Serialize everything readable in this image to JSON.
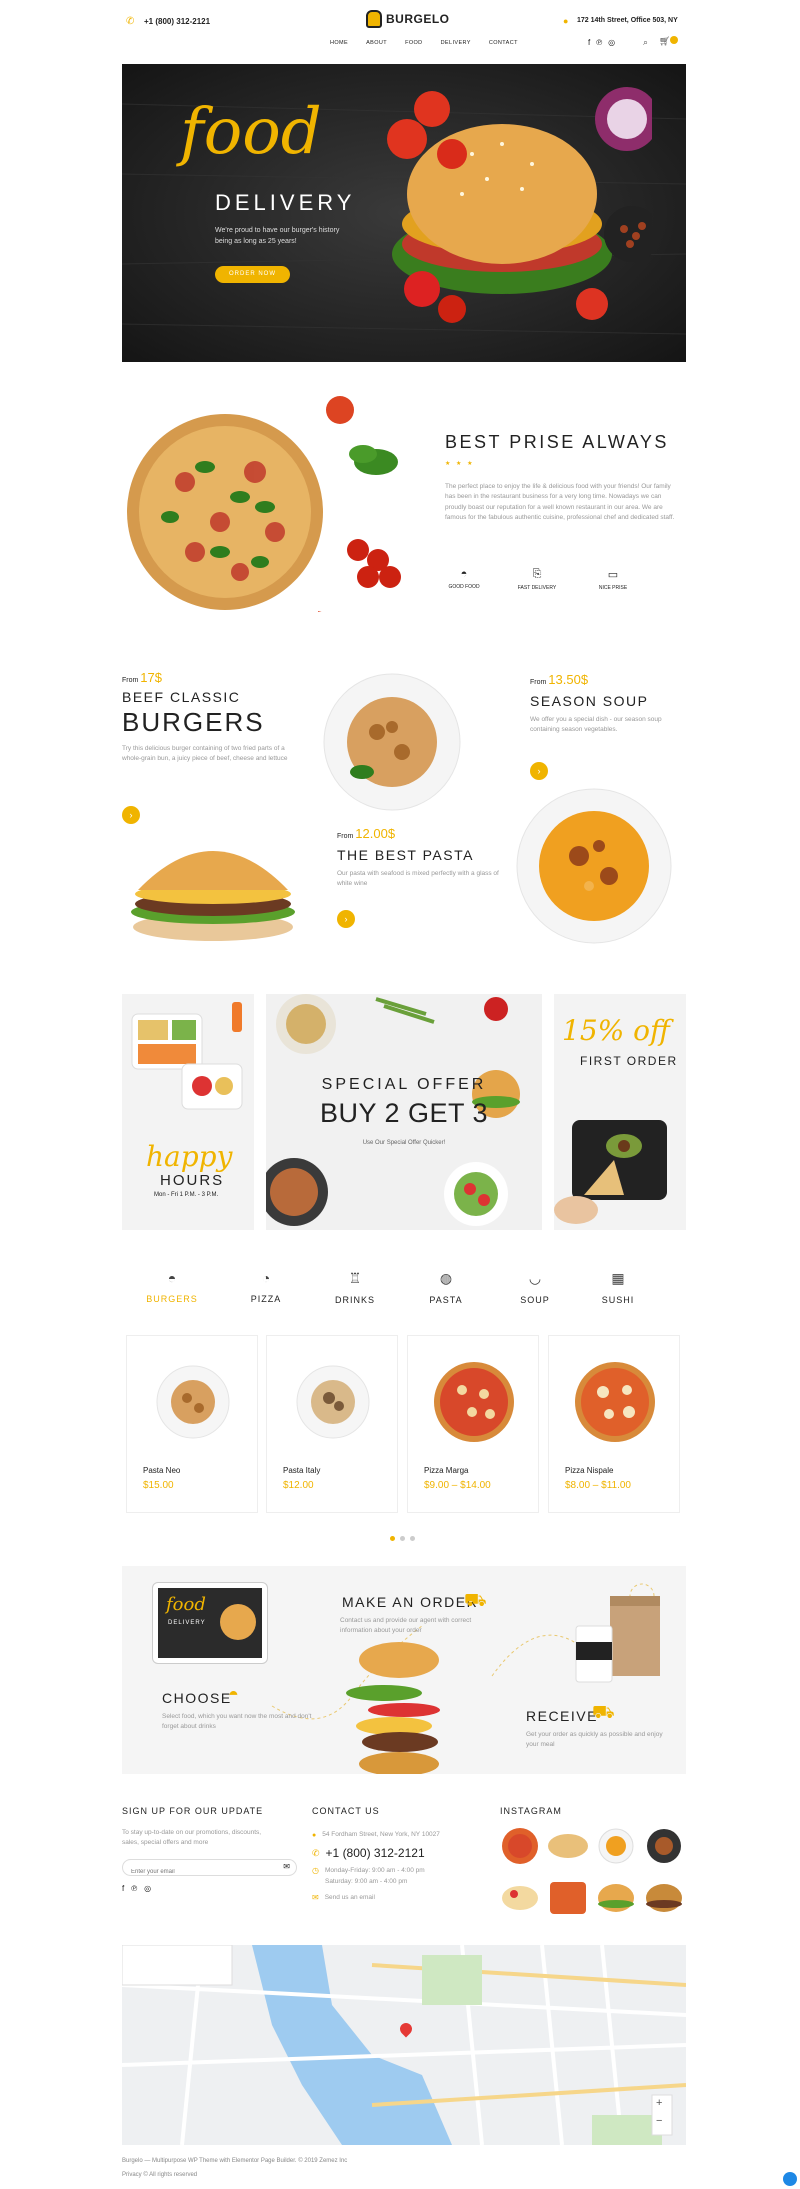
{
  "header": {
    "phone": "+1 (800) 312-2121",
    "logo_text": "BURGELO",
    "address": "172 14th Street, Office 503, NY",
    "nav": [
      "HOME",
      "ABOUT",
      "FOOD",
      "DELIVERY",
      "CONTACT"
    ],
    "cart_count": ""
  },
  "hero": {
    "script_title": "food",
    "title": "DELIVERY",
    "subtitle": "We're proud to have our burger's history being as long as 25 years!",
    "button": "ORDER NOW"
  },
  "about": {
    "title": "BEST PRISE ALWAYS",
    "stars": "★ ★ ★",
    "text": "The perfect place to enjoy the life & delicious food with your friends! Our family has been in the restaurant business for a very long time. Nowadays we can proudly boast our reputation for a well known restaurant in our area. We are famous for the fabulous authentic cuisine, professional chef and dedicated staff.",
    "features": [
      "GOOD FOOD",
      "FAST DELIVERY",
      "NICE PRISE"
    ]
  },
  "menu_items": {
    "burgers": {
      "from": "From",
      "price": "17$",
      "title1": "BEEF CLASSIC",
      "title2": "BURGERS",
      "text": "Try this delicious burger containing of two fried parts of a whole-grain bun, a juicy piece of beef, cheese and lettuce"
    },
    "soup": {
      "from": "From",
      "price": "13.50$",
      "title": "SEASON SOUP",
      "text": "We offer you a special dish - our season soup containing season vegetables."
    },
    "pasta": {
      "from": "From",
      "price": "12.00$",
      "title": "THE BEST PASTA",
      "text": "Our pasta with seafood is mixed perfectly with a glass of white wine"
    }
  },
  "offers": {
    "happy_script": "happy",
    "happy_title": "HOURS",
    "happy_time": "Mon - Fri 1 P.M. - 3 P.M.",
    "special_small": "SPECIAL OFFER",
    "special_big": "BUY 2 GET 3",
    "special_text": "Use Our Special Offer Quicker!",
    "discount_script": "15% off",
    "discount_title": "FIRST ORDER"
  },
  "categories": {
    "tabs": [
      "BURGERS",
      "PIZZA",
      "DRINKS",
      "PASTA",
      "SOUP",
      "SUSHI"
    ],
    "active": "BURGERS",
    "products": [
      {
        "name": "Pasta Neo",
        "price": "$15.00"
      },
      {
        "name": "Pasta Italy",
        "price": "$12.00"
      },
      {
        "name": "Pizza Marga",
        "price": "$9.00 – $14.00"
      },
      {
        "name": "Pizza Nispale",
        "price": "$8.00 – $11.00"
      }
    ]
  },
  "process": {
    "tablet_script": "food",
    "tablet_title": "DELIVERY",
    "order_title": "MAKE AN ORDER",
    "order_text": "Contact us and provide our agent with correct information about your order",
    "choose_title": "CHOOSE",
    "choose_text": "Select food, which you want now the most and don't forget about drinks",
    "receive_title": "RECEIVE",
    "receive_text": "Get your order as quickly as possible and enjoy your meal"
  },
  "footer": {
    "signup_title": "SIGN UP FOR OUR UPDATE",
    "signup_text": "To stay up-to-date on our promotions, discounts, sales, special offers and more",
    "email_placeholder": "Enter your email",
    "contact_title": "CONTACT US",
    "contact_address": "54 Fordham Street, New York, NY 10027",
    "contact_phone": "+1 (800) 312-2121",
    "contact_hours1": "Monday-Friday: 9:00 am - 4:00 pm",
    "contact_hours2": "Saturday: 9:00 am - 4:00 pm",
    "contact_mail": "Send us an email",
    "instagram_title": "INSTAGRAM",
    "copyright": "Burgelo — Multipurpose WP Theme with Elementor Page Builder. © 2019 Zemez Inc",
    "rights": "Privacy © All rights reserved"
  },
  "colors": {
    "accent": "#f0b400",
    "dark": "#2b2b2b"
  }
}
